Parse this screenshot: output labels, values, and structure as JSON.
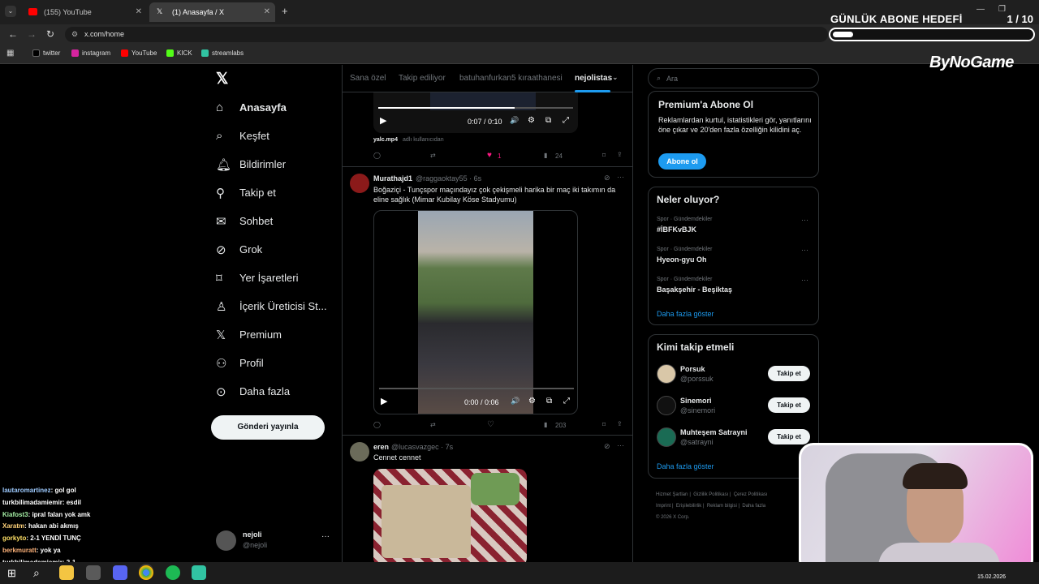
{
  "browser": {
    "tabs": [
      {
        "title": "(155) YouTube",
        "active": false
      },
      {
        "title": "(1) Anasayfa / X",
        "active": true
      }
    ],
    "url": "x.com/home",
    "bookmarks": [
      "twitter",
      "instagram",
      "YouTube",
      "KICK",
      "streamlabs"
    ]
  },
  "overlay": {
    "goal_title": "GÜNLÜK ABONE HEDEFİ",
    "goal_count": "1 / 10",
    "goal_progress": 0.1,
    "brand": "ByNoGame"
  },
  "nav": {
    "items": [
      {
        "label": "Anasayfa",
        "icon": "home-icon"
      },
      {
        "label": "Keşfet",
        "icon": "search-icon"
      },
      {
        "label": "Bildirimler",
        "icon": "bell-icon"
      },
      {
        "label": "Takip et",
        "icon": "add-person-icon"
      },
      {
        "label": "Sohbet",
        "icon": "mail-icon"
      },
      {
        "label": "Grok",
        "icon": "grok-icon"
      },
      {
        "label": "Yer İşaretleri",
        "icon": "bookmark-icon"
      },
      {
        "label": "İçerik Üreticisi St...",
        "icon": "creator-icon"
      },
      {
        "label": "Premium",
        "icon": "x-premium-icon"
      },
      {
        "label": "Profil",
        "icon": "person-icon"
      },
      {
        "label": "Daha fazla",
        "icon": "more-circle-icon"
      }
    ],
    "post_button": "Gönderi yayınla",
    "account": {
      "name": "nejoli",
      "handle": "@nejoli"
    }
  },
  "timeline": {
    "tabs": [
      "Sana özel",
      "Takip ediliyor",
      "batuhanfurkan5 kıraathanesi",
      "nejolistas"
    ],
    "tweet0": {
      "video_time": "0:07 / 0:10",
      "caption_user": "yalc.mp4",
      "caption_rest": "adlı kullanıcıdan",
      "likes": "1",
      "views": "24"
    },
    "tweet1": {
      "name": "Murathajd1",
      "handle": "@raggaoktay55 · 6s",
      "text": "Boğaziçi - Tunçspor maçındayız çok çekişmeli harika bir maç iki takımın da eline sağlık (Mimar Kubilay Köse Stadyumu)",
      "video_time": "0:00 / 0:06",
      "views": "203"
    },
    "tweet2": {
      "name": "eren",
      "handle": "@lucasvazgec · 7s",
      "text": "Cennet cennet"
    }
  },
  "sidebar": {
    "search_placeholder": "Ara",
    "premium": {
      "title": "Premium'a Abone Ol",
      "text": "Reklamlardan kurtul, istatistikleri gör, yanıtlarını öne çıkar ve 20'den fazla özelliğin kilidini aç.",
      "button": "Abone ol"
    },
    "trends": {
      "title": "Neler oluyor?",
      "items": [
        {
          "meta": "Spor · Gündemdekiler",
          "name": "#İBFKvBJK"
        },
        {
          "meta": "Spor · Gündemdekiler",
          "name": "Hyeon-gyu Oh"
        },
        {
          "meta": "Spor · Gündemdekiler",
          "name": "Başakşehir - Beşiktaş"
        }
      ],
      "more": "Daha fazla göster"
    },
    "who_to_follow": {
      "title": "Kimi takip etmeli",
      "items": [
        {
          "name": "Porsuk",
          "handle": "@porssuk",
          "button": "Takip et"
        },
        {
          "name": "Sinemori",
          "handle": "@sinemori",
          "button": "Takip et"
        },
        {
          "name": "Muhteşem Satrayni",
          "handle": "@satrayni",
          "button": "Takip et"
        }
      ],
      "more": "Daha fazla göster"
    },
    "footer": {
      "row1": [
        "Hizmet Şartları",
        "Gizlilik Politikası",
        "Çerez Politikası"
      ],
      "row2": [
        "Imprint",
        "Erişilebilirlik",
        "Reklam bilgisi",
        "Daha fazla"
      ],
      "copyright": "© 2026 X Corp."
    }
  },
  "chat": [
    {
      "user": "lautaromartinez",
      "msg": ": gol gol",
      "color": "#9ecbff"
    },
    {
      "user": "turkbilimadamiemir",
      "msg": ": esdil",
      "color": "#ffffff"
    },
    {
      "user": "Kiafost3",
      "msg": ": ipral falan yok amk",
      "color": "#a6f0a6"
    },
    {
      "user": "Xaratm",
      "msg": ": hakan abi akmış",
      "color": "#ffd27a"
    },
    {
      "user": "gorkyto",
      "msg": ": 2-1 YENDİ TUNÇ",
      "color": "#ffe066"
    },
    {
      "user": "berkmuratt",
      "msg": ": yok ya",
      "color": "#ffb37a"
    },
    {
      "user": "turkbilimadamiemir",
      "msg": ": 2-1",
      "color": "#ffffff"
    }
  ],
  "taskbar": {
    "date": "15.02.2026"
  }
}
